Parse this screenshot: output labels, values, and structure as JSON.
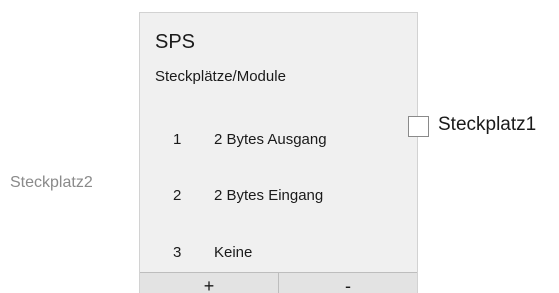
{
  "left_label": "Steckplatz2",
  "panel": {
    "title": "SPS",
    "subtitle": "Steckplätze/Module",
    "slots": [
      {
        "number": "1",
        "label": "2 Bytes Ausgang"
      },
      {
        "number": "2",
        "label": "2 Bytes Eingang"
      },
      {
        "number": "3",
        "label": "Keine"
      }
    ],
    "add_button": "+",
    "remove_button": "-"
  },
  "right_checkbox": {
    "label": "Steckplatz1",
    "checked": false
  }
}
